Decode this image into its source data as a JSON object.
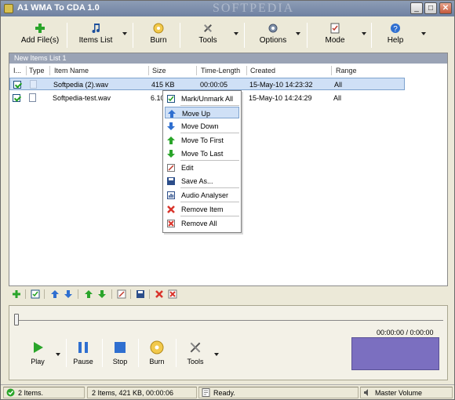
{
  "window": {
    "title": "A1 WMA To CDA 1.0",
    "watermark": "SOFTPEDIA",
    "minimize": "_",
    "maximize": "□",
    "close": "✕"
  },
  "toolbar": [
    {
      "label": "Add File(s)",
      "icon": "add-icon"
    },
    {
      "label": "Items List",
      "icon": "music-note-icon"
    },
    {
      "label": "Burn",
      "icon": "cd-icon"
    },
    {
      "label": "Tools",
      "icon": "tools-icon"
    },
    {
      "label": "Options",
      "icon": "options-gear-icon"
    },
    {
      "label": "Mode",
      "icon": "checklist-icon"
    },
    {
      "label": "Help",
      "icon": "help-icon"
    }
  ],
  "list": {
    "title": "New Items List 1",
    "columns": [
      "I...",
      "Type",
      "Item Name",
      "Size",
      "Time-Length",
      "Created",
      "Range"
    ],
    "rows": [
      {
        "name": "Softpedia (2).wav",
        "size": "415 KB",
        "time": "00:00:05",
        "created": "15-May-10 14:23:32",
        "range": "All",
        "selected": true
      },
      {
        "name": "Softpedia-test.wav",
        "size": "6.10",
        "time": "",
        "created": "15-May-10 14:24:29",
        "range": "All",
        "selected": false
      }
    ]
  },
  "context_menu": [
    {
      "label": "Mark/Unmark All",
      "icon": "checkmark-icon"
    },
    {
      "label": "Move Up",
      "icon": "arrow-up-icon",
      "highlighted": true
    },
    {
      "label": "Move Down",
      "icon": "arrow-down-icon"
    },
    {
      "label": "Move To First",
      "icon": "arrow-up-green-icon"
    },
    {
      "label": "Move To Last",
      "icon": "arrow-down-green-icon"
    },
    {
      "label": "Edit",
      "icon": "edit-icon"
    },
    {
      "label": "Save As...",
      "icon": "save-icon"
    },
    {
      "label": "Audio Analyser",
      "icon": "analyser-icon"
    },
    {
      "label": "Remove Item",
      "icon": "remove-icon"
    },
    {
      "label": "Remove All",
      "icon": "remove-all-icon"
    }
  ],
  "player": {
    "time": "00:00:00 / 0:00:00",
    "buttons": [
      {
        "label": "Play",
        "icon": "play-icon"
      },
      {
        "label": "Pause",
        "icon": "pause-icon"
      },
      {
        "label": "Stop",
        "icon": "stop-icon"
      },
      {
        "label": "Burn",
        "icon": "cd-icon"
      },
      {
        "label": "Tools",
        "icon": "tools-icon"
      }
    ]
  },
  "status": {
    "items": "2 Items.",
    "summary": "2 Items, 421 KB, 00:00:06",
    "state": "Ready.",
    "volume": "Master Volume"
  },
  "colors": {
    "selection": "#cfe0f6",
    "visualizer": "#7b6fc0",
    "title_gradient_top": "#8d9db6"
  }
}
